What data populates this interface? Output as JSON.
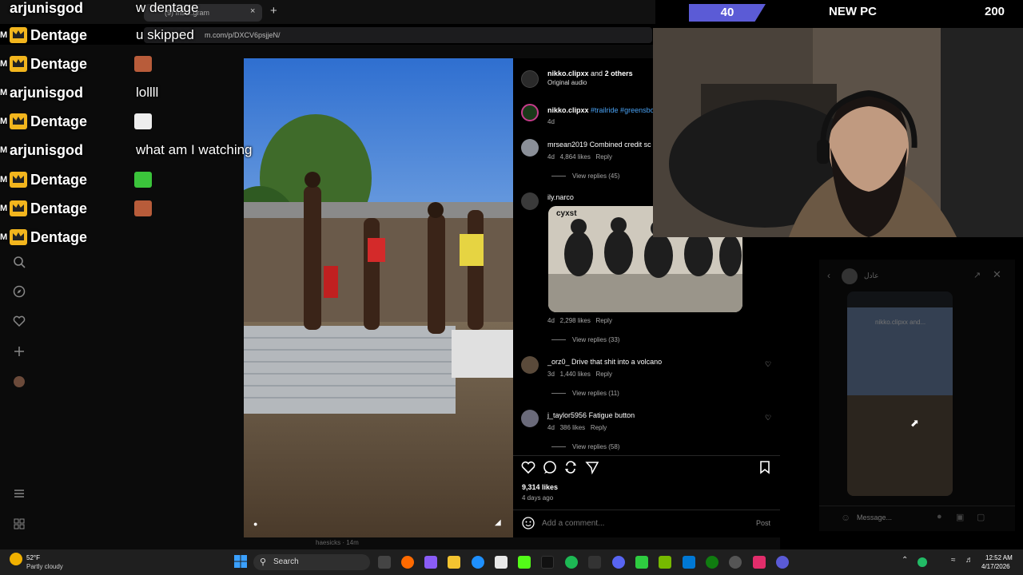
{
  "browser": {
    "tab_title": "(9) Inst...gram",
    "tab_close": "×",
    "new_tab": "+",
    "url": "m.com/p/DXCV6psjjeN/"
  },
  "chat": {
    "lines": [
      {
        "prefix": "",
        "user": "arjunisgod",
        "message": "w dentage",
        "badge": false
      },
      {
        "prefix": "M",
        "user": "Dentage",
        "message": "u skipped",
        "badge": true
      },
      {
        "prefix": "M",
        "user": "Dentage",
        "message": "",
        "badge": true
      },
      {
        "prefix": "M",
        "user": "arjunisgod",
        "message": "lollll",
        "badge": false
      },
      {
        "prefix": "M",
        "user": "Dentage",
        "message": "",
        "badge": true
      },
      {
        "prefix": "M",
        "user": "arjunisgod",
        "message": "what am I watching",
        "badge": false
      },
      {
        "prefix": "M",
        "user": "Dentage",
        "message": "",
        "badge": true
      },
      {
        "prefix": "M",
        "user": "Dentage",
        "message": "",
        "badge": true
      },
      {
        "prefix": "M",
        "user": "Dentage",
        "message": "",
        "badge": true
      }
    ]
  },
  "post": {
    "author": "nikko.clipxx",
    "and_text": "and",
    "others": "2 others",
    "audio": "Original audio",
    "caption_user": "nikko.clipxx",
    "caption_tags": "#trailride #greensbo",
    "caption_age": "4d",
    "likes": "9,314 likes",
    "posted": "4 days ago",
    "comment_placeholder": "Add a comment...",
    "post_button": "Post"
  },
  "comments": [
    {
      "user": "mrsean2019",
      "text": "Combined credit sc",
      "age": "4d",
      "likes": "4,864 likes",
      "reply": "Reply",
      "view_replies": "View replies (45)"
    },
    {
      "user": "ily.narco",
      "text": "",
      "age": "4d",
      "likes": "2,298 likes",
      "reply": "Reply",
      "view_replies": "View replies (33)",
      "gif_caption": "cyxst"
    },
    {
      "user": "_orz0_",
      "text": "Drive that shit into a volcano",
      "age": "3d",
      "likes": "1,440 likes",
      "reply": "Reply",
      "view_replies": "View replies (11)"
    },
    {
      "user": "j_taylor5956",
      "text": "Fatigue button",
      "age": "4d",
      "likes": "386 likes",
      "reply": "Reply",
      "view_replies": "View replies (58)"
    }
  ],
  "dm": {
    "name": "عادل",
    "shared_label": "nikko.clipxx and...",
    "message_placeholder": "Message..."
  },
  "overlay": {
    "badge_count": "40",
    "new_pc": "NEW PC",
    "goal_count": "200"
  },
  "footer_notice": {
    "user": "haesicks",
    "age": "14m"
  },
  "taskbar": {
    "weather_temp": "52°F",
    "weather_desc": "Partly cloudy",
    "search_label": "Search",
    "time": "12:52 AM",
    "date": "4/17/2026"
  },
  "colors": {
    "badge_purple": "#5b5bd6",
    "crown_gold": "#f2b51d",
    "link_blue": "#4aa3f5",
    "instagram_bg": "#000000"
  }
}
